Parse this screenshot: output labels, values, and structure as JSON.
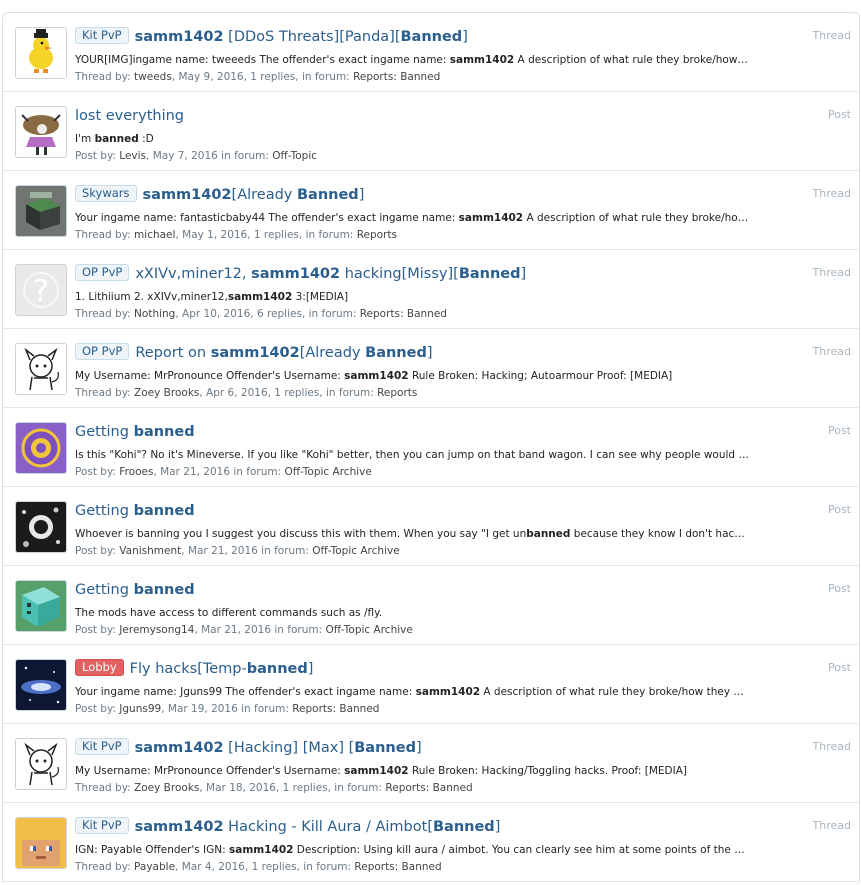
{
  "results": [
    {
      "prefix": "Kit PvP",
      "prefix_red": false,
      "title": [
        "samm1402",
        " [DDoS Threats][Panda][",
        "Banned",
        "]"
      ],
      "title_bold": [
        true,
        false,
        true,
        false
      ],
      "snippet": [
        "YOUR[IMG]ingame name: tweeeds The offender's exact ingame name: ",
        "samm1402",
        " A description of what rule they broke/how they broke it: ddosing..."
      ],
      "meta_kind": "Thread by:",
      "user": "tweeds",
      "details": ", May 9, 2016, 1 replies, in forum: ",
      "forum": "Reports: Banned",
      "type": "Thread",
      "avatar": "duck-avatar-icon"
    },
    {
      "prefix": "",
      "prefix_red": false,
      "title": [
        "lost everything"
      ],
      "title_bold": [
        false
      ],
      "snippet": [
        "I'm ",
        "banned",
        " :D"
      ],
      "meta_kind": "Post by:",
      "user": "Levis",
      "details": ", May 7, 2016 in forum: ",
      "forum": "Off-Topic",
      "type": "Post",
      "avatar": "dancer-avatar-icon"
    },
    {
      "prefix": "Skywars",
      "prefix_red": false,
      "title": [
        "samm1402",
        "[Already ",
        "Banned",
        "]"
      ],
      "title_bold": [
        true,
        false,
        true,
        false
      ],
      "snippet": [
        "Your ingame name: fantasticbaby44 The offender's exact ingame name: ",
        "samm1402",
        " A description of what rule they broke/how they broke it:..."
      ],
      "meta_kind": "Thread by:",
      "user": "michael",
      "details": ", May 1, 2016, 1 replies, in forum: ",
      "forum": "Reports",
      "type": "Thread",
      "avatar": "block-avatar-icon"
    },
    {
      "prefix": "OP PvP",
      "prefix_red": false,
      "title": [
        "xXIVv,miner12, ",
        "samm1402",
        " hacking[Missy][",
        "Banned",
        "]"
      ],
      "title_bold": [
        false,
        true,
        false,
        true,
        false
      ],
      "snippet": [
        "1. Lithiium 2. xXIVv,miner12,",
        "samm1402",
        " 3:[MEDIA]"
      ],
      "meta_kind": "Thread by:",
      "user": "Nothing",
      "details": ", Apr 10, 2016, 6 replies, in forum: ",
      "forum": "Reports: Banned",
      "type": "Thread",
      "avatar": "question-avatar-icon"
    },
    {
      "prefix": "OP PvP",
      "prefix_red": false,
      "title": [
        "Report on ",
        "samm1402",
        "[Already ",
        "Banned",
        "]"
      ],
      "title_bold": [
        false,
        true,
        false,
        true,
        false
      ],
      "snippet": [
        "My Username: MrPronounce Offender's Username: ",
        "samm1402",
        " Rule Broken: Hacking; Autoarmour Proof: [MEDIA]"
      ],
      "meta_kind": "Thread by:",
      "user": "Zoey Brooks",
      "details": ", Apr 6, 2016, 1 replies, in forum: ",
      "forum": "Reports",
      "type": "Thread",
      "avatar": "sketch-avatar-icon"
    },
    {
      "prefix": "",
      "prefix_red": false,
      "title": [
        "Getting ",
        "banned"
      ],
      "title_bold": [
        false,
        true
      ],
      "snippet": [
        "Is this \"Kohi\"? No it's Mineverse. If you like \"Kohi\" better, then you can jump on that band wagon. I can see why people would not support you,..."
      ],
      "meta_kind": "Post by:",
      "user": "Frooes",
      "details": ", Mar 21, 2016 in forum: ",
      "forum": "Off-Topic Archive",
      "type": "Post",
      "avatar": "badge-avatar-icon"
    },
    {
      "prefix": "",
      "prefix_red": false,
      "title": [
        "Getting ",
        "banned"
      ],
      "title_bold": [
        false,
        true
      ],
      "snippet": [
        "Whoever is banning you I suggest you discuss this with them. When you say \"I get un",
        "banned",
        " because they know I don't hack\", that is most likely..."
      ],
      "meta_kind": "Post by:",
      "user": "Vanishment",
      "details": ", Mar 21, 2016 in forum: ",
      "forum": "Off-Topic Archive",
      "type": "Post",
      "avatar": "dark-avatar-icon"
    },
    {
      "prefix": "",
      "prefix_red": false,
      "title": [
        "Getting ",
        "banned"
      ],
      "title_bold": [
        false,
        true
      ],
      "snippet": [
        "The mods have access to different commands such as /fly."
      ],
      "meta_kind": "Post by:",
      "user": "Jeremysong14",
      "details": ", Mar 21, 2016 in forum: ",
      "forum": "Off-Topic Archive",
      "type": "Post",
      "avatar": "teal-block-avatar-icon"
    },
    {
      "prefix": "Lobby",
      "prefix_red": true,
      "title": [
        "Fly hacks[Temp-",
        "banned",
        "]"
      ],
      "title_bold": [
        false,
        true,
        false
      ],
      "snippet": [
        "Your ingame name: Jguns99 The offender's exact ingame name: ",
        "samm1402",
        " A description of what rule they broke/how they broke it: flying in lobby..."
      ],
      "meta_kind": "Post by:",
      "user": "Jguns99",
      "details": ", Mar 19, 2016 in forum: ",
      "forum": "Reports: Banned",
      "type": "Post",
      "avatar": "galaxy-avatar-icon"
    },
    {
      "prefix": "Kit PvP",
      "prefix_red": false,
      "title": [
        "samm1402",
        " [Hacking] [Max] [",
        "Banned",
        "]"
      ],
      "title_bold": [
        true,
        false,
        true,
        false
      ],
      "snippet": [
        "My Username: MrPronounce Offender's Username: ",
        "samm1402",
        " Rule Broken: Hacking/Toggling hacks. Proof: [MEDIA]"
      ],
      "meta_kind": "Thread by:",
      "user": "Zoey Brooks",
      "details": ", Mar 18, 2016, 1 replies, in forum: ",
      "forum": "Reports: Banned",
      "type": "Thread",
      "avatar": "sketch-avatar-icon"
    },
    {
      "prefix": "Kit PvP",
      "prefix_red": false,
      "title": [
        "samm1402",
        " Hacking - Kill Aura / Aimbot[",
        "Banned",
        "]"
      ],
      "title_bold": [
        true,
        false,
        true,
        false
      ],
      "snippet": [
        "IGN: Payable Offender's IGN: ",
        "samm1402",
        " Description: Using kill aura / aimbot. You can clearly see him at some points of the video aiming at other..."
      ],
      "meta_kind": "Thread by:",
      "user": "Payable",
      "details": ", Mar 4, 2016, 1 replies, in forum: ",
      "forum": "Reports: Banned",
      "type": "Thread",
      "avatar": "pixel-face-avatar-icon"
    }
  ],
  "snippet_bold_map": [
    [
      false,
      true,
      false
    ],
    [
      false,
      true,
      false
    ],
    [
      false,
      true,
      false
    ],
    [
      false,
      true,
      false
    ],
    [
      false,
      true,
      false
    ],
    [
      false
    ],
    [
      false,
      true,
      false
    ],
    [
      false
    ],
    [
      false,
      true,
      false
    ],
    [
      false,
      true,
      false
    ],
    [
      false,
      true,
      false
    ]
  ],
  "colors": {
    "link": "#2a5e8e",
    "prefix_bg": "#eef4f8",
    "prefix_red": "#e46161",
    "meta": "#6b7a86",
    "type": "#a9b6c0"
  }
}
